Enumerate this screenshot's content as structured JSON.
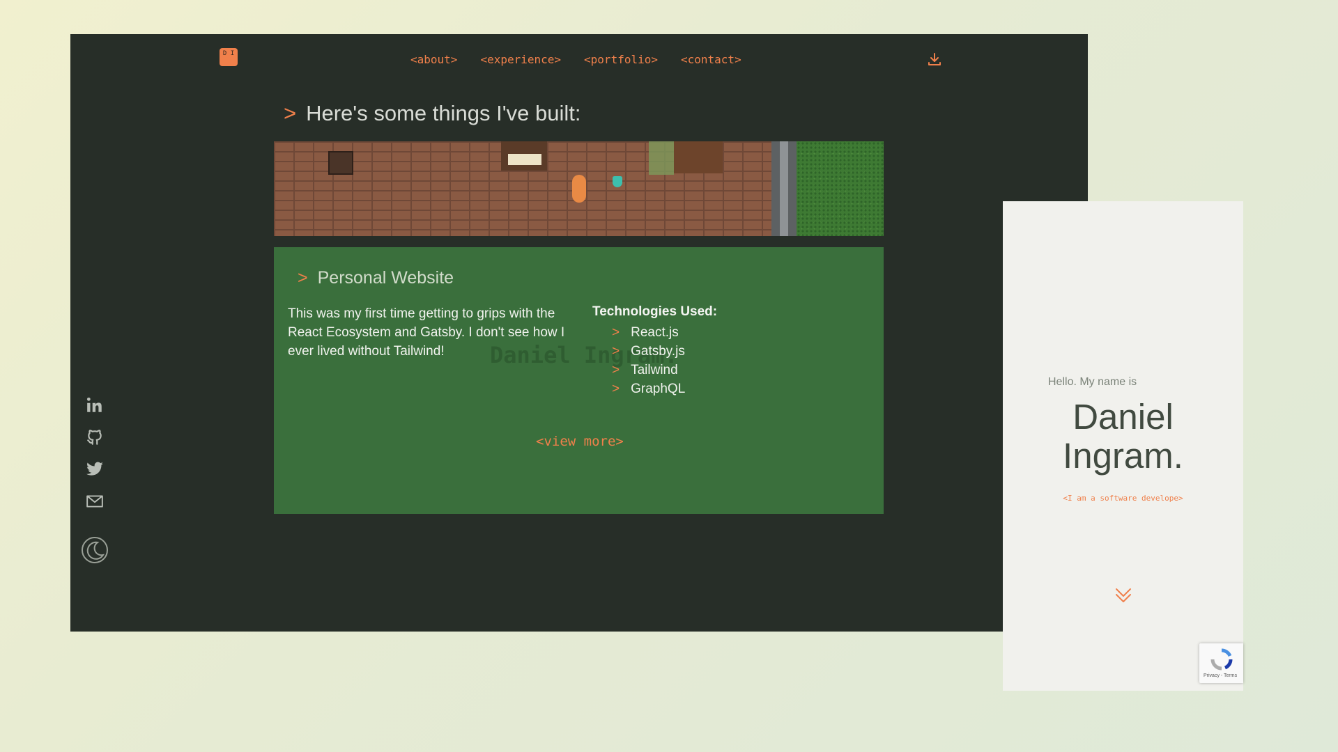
{
  "logo": {
    "text": "D I"
  },
  "nav": {
    "items": [
      {
        "label": "<about>"
      },
      {
        "label": "<experience>"
      },
      {
        "label": "<portfolio>"
      },
      {
        "label": "<contact>"
      }
    ]
  },
  "section": {
    "prompt": ">",
    "title": "Here's some things I've built:"
  },
  "project": {
    "prompt": ">",
    "title": "Personal Website",
    "description": "This was my first time getting to grips with the React Ecosystem and Gatsby. I don't see how I ever lived without Tailwind!",
    "tech_heading": "Technologies Used:",
    "technologies": [
      "React.js",
      "Gatsby.js",
      "Tailwind",
      "GraphQL"
    ],
    "view_more": "<view more>"
  },
  "social": {
    "icons": [
      "linkedin-icon",
      "github-icon",
      "twitter-icon",
      "mail-icon"
    ],
    "theme_toggle": "moon-icon"
  },
  "mobile": {
    "greeting": "Hello. My name is",
    "name_line1": "Daniel",
    "name_line2": "Ingram.",
    "role": "<I am a software develope>"
  },
  "recaptcha": {
    "links": "Privacy - Terms"
  },
  "colors": {
    "accent": "#f0804b",
    "dark_bg": "#272e28",
    "card_bg": "#3a6f3c",
    "light_bg": "#f1f1ed"
  }
}
